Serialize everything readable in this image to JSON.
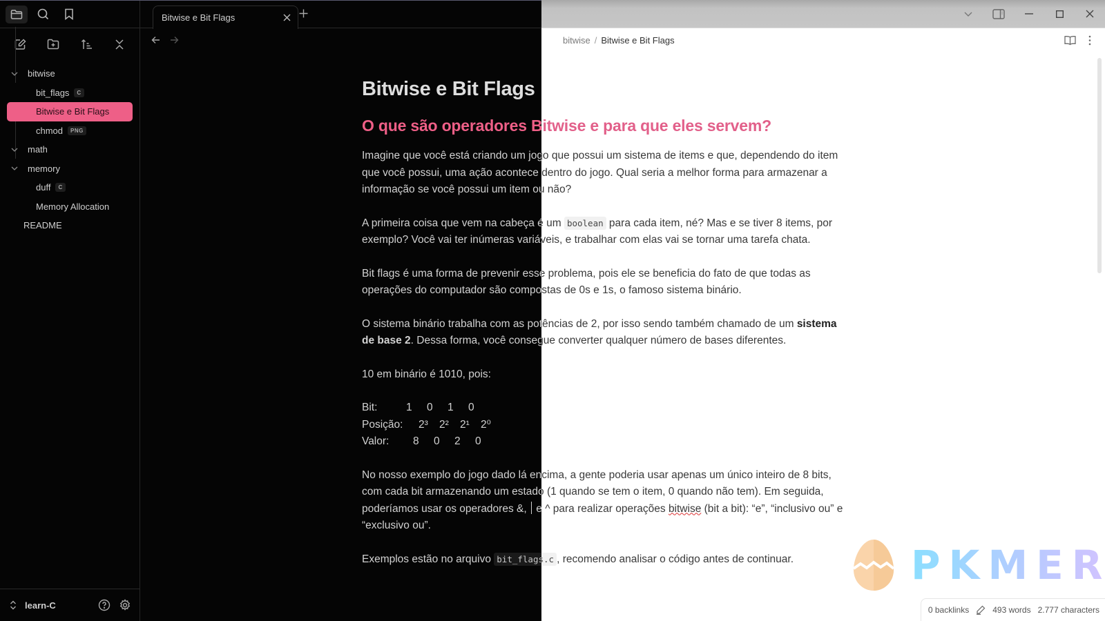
{
  "window": {
    "title": "Bitwise e Bit Flags",
    "controls": [
      "chevron-down",
      "sidebar-toggle",
      "minimize",
      "maximize",
      "close"
    ]
  },
  "ribbon": {
    "items": [
      {
        "name": "files",
        "icon": "folder-icon",
        "active": true
      },
      {
        "name": "search",
        "icon": "search-icon",
        "active": false
      },
      {
        "name": "bookmarks",
        "icon": "bookmark-icon",
        "active": false
      }
    ]
  },
  "file_explorer": {
    "actions": [
      "new-note",
      "new-folder",
      "change-sort-order",
      "collapse-all"
    ],
    "tree": [
      {
        "type": "folder",
        "label": "bitwise",
        "expanded": true,
        "children": [
          {
            "label": "bit_flags",
            "tag": "C",
            "selected": false
          },
          {
            "label": "Bitwise e Bit Flags",
            "tag": null,
            "selected": true
          },
          {
            "label": "chmod",
            "tag": "PNG",
            "selected": false
          }
        ]
      },
      {
        "type": "folder",
        "label": "math",
        "expanded": true,
        "children": []
      },
      {
        "type": "folder",
        "label": "memory",
        "expanded": true,
        "children": [
          {
            "label": "duff",
            "tag": "C",
            "selected": false
          },
          {
            "label": "Memory Allocation",
            "tag": null,
            "selected": false
          }
        ]
      },
      {
        "type": "file",
        "label": "README"
      }
    ]
  },
  "vault": {
    "name": "learn-C"
  },
  "tabs": [
    {
      "label": "Bitwise e Bit Flags",
      "active": true
    }
  ],
  "breadcrumb": {
    "parent": "bitwise",
    "separator": "/",
    "current": "Bitwise e Bit Flags"
  },
  "document": {
    "title": "Bitwise e Bit Flags",
    "heading": "O que são operadores Bitwise e para que eles servem?",
    "p1": "Imagine que você está criando um jogo que possui um sistema de items e que, dependendo do item que você possui, uma ação acontece dentro do jogo. Qual seria a melhor forma para armazenar a informação se você possui um item ou não?",
    "p2_before": "A primeira coisa que vem na cabeça é um ",
    "p2_code": "boolean",
    "p2_after": " para cada item, né? Mas e se tiver 8 items, por exemplo? Você vai ter inúmeras variáveis, e trabalhar com elas vai se tornar uma tarefa chata.",
    "p3": "Bit flags é uma forma de prevenir esse problema, pois ele se beneficia do fato de que todas as operações do computador são compostas de 0s e 1s, o famoso sistema binário.",
    "p4_before": "O sistema binário trabalha com as potências de 2, por isso sendo também chamado de um ",
    "p4_bold": "sistema de base 2",
    "p4_after": ". Dessa forma, você consegue converter qualquer número de bases diferentes.",
    "p5": "10 em binário é 1010, pois:",
    "bit_table": {
      "rows": [
        {
          "label": "Bit:",
          "values": [
            "1",
            "0",
            "1",
            "0"
          ]
        },
        {
          "label": "Posição:",
          "values": [
            "2³",
            "2²",
            "2¹",
            "2⁰"
          ]
        },
        {
          "label": "Valor:",
          "values": [
            "8",
            "0",
            "2",
            "0"
          ]
        }
      ]
    },
    "p6_before": "No nosso exemplo do jogo dado lá encima, a gente poderia usar apenas um único inteiro de 8 bits, com cada bit armazenando um estado (1 quando se tem o item, 0 quando não tem). Em seguida, poderíamos usar os operadores &, ",
    "p6_mid": " e ^ para realizar operações ",
    "p6_spell": "bitwise",
    "p6_after": " (bit a bit): “e”, “inclusivo ou” e “exclusivo ou”.",
    "p7_before": "Exemplos estão no arquivo ",
    "p7_code": "bit_flags.c",
    "p7_after": ", recomendo analisar o código antes de continuar."
  },
  "status_bar": {
    "backlinks": "0 backlinks",
    "words": "493 words",
    "characters": "2.777 characters"
  },
  "watermark": {
    "text": "PKMER"
  },
  "theme": {
    "accent": "#ee5f87",
    "dark_bg": "#050505",
    "light_bg": "#ffffff"
  }
}
